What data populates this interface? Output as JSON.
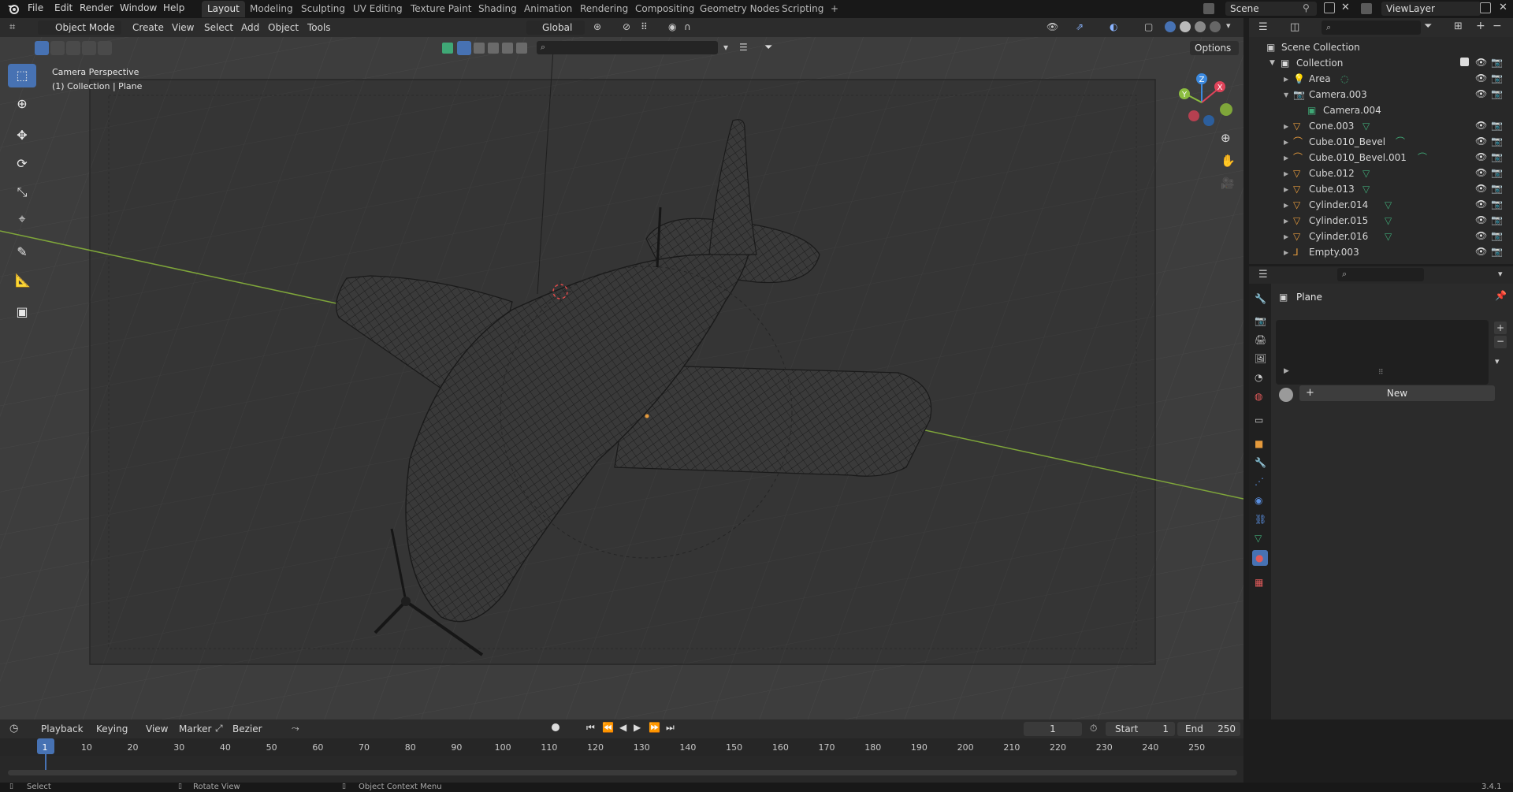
{
  "topbar": {
    "menus": [
      "File",
      "Edit",
      "Render",
      "Window",
      "Help"
    ],
    "workspaces": [
      "Layout",
      "Modeling",
      "Sculpting",
      "UV Editing",
      "Texture Paint",
      "Shading",
      "Animation",
      "Rendering",
      "Compositing",
      "Geometry Nodes",
      "Scripting"
    ],
    "active_workspace": "Layout",
    "add_tab": "+",
    "scene": "Scene",
    "view_layer": "ViewLayer"
  },
  "viewport_header": {
    "mode": "Object Mode",
    "menus": [
      "Create",
      "View",
      "Select",
      "Add",
      "Object",
      "Tools"
    ],
    "transform_orientation": "Global",
    "options": "Options"
  },
  "viewport": {
    "overlay_line1": "Camera Perspective",
    "overlay_line2": "(1) Collection | Plane",
    "gizmo_axes": {
      "x": "X",
      "y": "Y",
      "z": "Z"
    },
    "tools": [
      "select-box-icon",
      "cursor-icon",
      "move-icon",
      "rotate-icon",
      "scale-icon",
      "transform-icon",
      "annotate-icon",
      "measure-icon",
      "add-cube-icon"
    ]
  },
  "outliner": {
    "root": "Scene Collection",
    "collection": "Collection",
    "items": [
      {
        "name": "Area",
        "type": "light",
        "depth": 1
      },
      {
        "name": "Camera.003",
        "type": "camera",
        "depth": 1,
        "expanded": true
      },
      {
        "name": "Camera.004",
        "type": "camera-data",
        "depth": 2
      },
      {
        "name": "Cone.003",
        "type": "mesh",
        "depth": 1
      },
      {
        "name": "Cube.010_Bevel",
        "type": "curve",
        "depth": 1
      },
      {
        "name": "Cube.010_Bevel.001",
        "type": "curve",
        "depth": 1
      },
      {
        "name": "Cube.012",
        "type": "mesh",
        "depth": 1
      },
      {
        "name": "Cube.013",
        "type": "mesh",
        "depth": 1
      },
      {
        "name": "Cylinder.014",
        "type": "mesh",
        "depth": 1
      },
      {
        "name": "Cylinder.015",
        "type": "mesh",
        "depth": 1
      },
      {
        "name": "Cylinder.016",
        "type": "mesh",
        "depth": 1
      },
      {
        "name": "Empty.003",
        "type": "empty",
        "depth": 1
      }
    ]
  },
  "properties": {
    "object_name": "Plane",
    "new_button": "New"
  },
  "timeline": {
    "menus": [
      "Playback",
      "Keying",
      "View",
      "Marker"
    ],
    "interpolation": "Bezier",
    "current_frame": "1",
    "start_label": "Start",
    "start_value": "1",
    "end_label": "End",
    "end_value": "250",
    "ticks": [
      "1",
      "10",
      "20",
      "30",
      "40",
      "50",
      "60",
      "70",
      "80",
      "90",
      "100",
      "110",
      "120",
      "130",
      "140",
      "150",
      "160",
      "170",
      "180",
      "190",
      "200",
      "210",
      "220",
      "230",
      "240",
      "250"
    ]
  },
  "statusbar": {
    "select": "Select",
    "rotate": "Rotate View",
    "context": "Object Context Menu",
    "version": "3.4.1"
  },
  "colors": {
    "accent": "#4772b3",
    "x_axis": "#e0435a",
    "y_axis": "#8bbc3f",
    "z_axis": "#3c8ae0",
    "grid_line": "#7fa63a",
    "mesh_orange": "#e59a3c",
    "camera_green": "#5bc4a0"
  }
}
